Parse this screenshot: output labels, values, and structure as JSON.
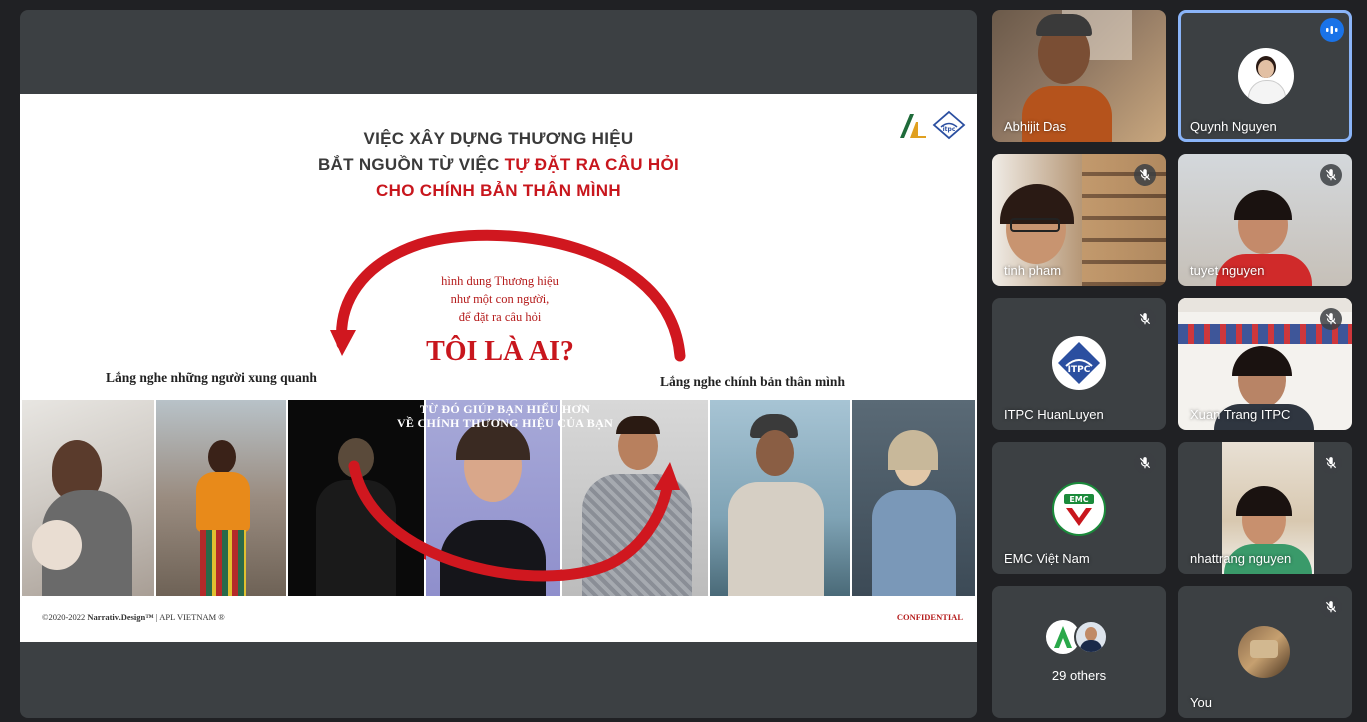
{
  "presentation": {
    "title_line1": "VIỆC XÂY DỰNG THƯƠNG HIỆU",
    "title_line2_part1": "BẮT NGUỒN TỪ VIỆC ",
    "title_line2_part2": "TỰ ĐẶT RA CÂU HỎI",
    "title_line3": "CHO CHÍNH BẢN THÂN MÌNH",
    "arc_text_line1": "hình dung Thương hiệu",
    "arc_text_line2": "như một con người,",
    "arc_text_line3": "để đặt ra câu hỏi",
    "question": "TÔI LÀ AI?",
    "label_left": "Lắng nghe những người xung quanh",
    "label_right": "Lắng nghe chính bản thân mình",
    "photo_caption_line1": "TỪ ĐÓ GIÚP BẠN HIỂU HƠN",
    "photo_caption_line2": "VỀ CHÍNH THƯƠNG HIỆU CỦA BẠN",
    "copyright_prefix": "©2020-2022 ",
    "copyright_brand": "Narrativ.Design™",
    "copyright_suffix": " | APL VIETNAM ®",
    "confidential": "CONFIDENTIAL"
  },
  "participants": [
    {
      "name": "Abhijit Das",
      "muted": false
    },
    {
      "name": "Quynh Nguyen",
      "muted": false,
      "speaking": true
    },
    {
      "name": "tinh pham",
      "muted": true
    },
    {
      "name": "tuyet nguyen",
      "muted": true
    },
    {
      "name": "ITPC HuanLuyen",
      "muted": true
    },
    {
      "name": "Xuan Trang ITPC",
      "muted": true
    },
    {
      "name": "EMC Việt Nam",
      "muted": true
    },
    {
      "name": "nhattrang nguyen",
      "muted": true
    },
    {
      "name": "29 others"
    },
    {
      "name": "You",
      "muted": true
    }
  ],
  "logos": {
    "itpc_text": "ITPC",
    "emc_text": "EMC"
  },
  "colors": {
    "accent_red": "#c8161d",
    "tile_bg": "#3c4043",
    "active_border": "#8ab4f8"
  }
}
